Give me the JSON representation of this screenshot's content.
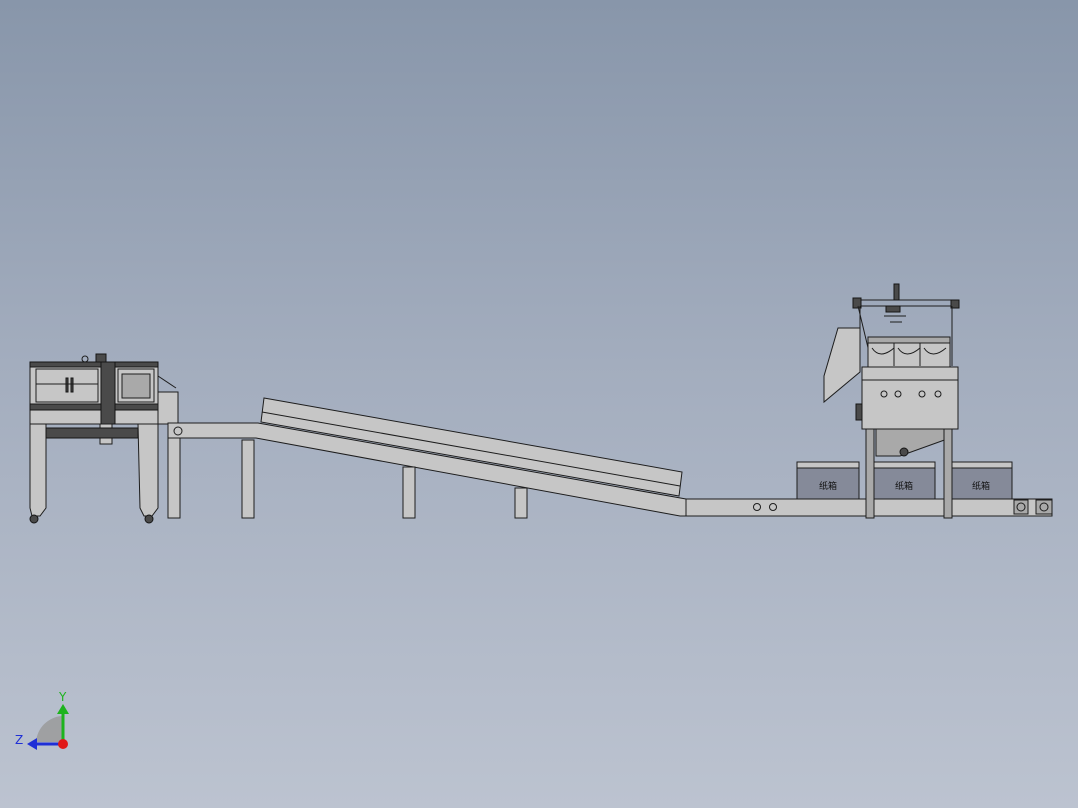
{
  "model": {
    "bin_labels": [
      "纸箱",
      "纸箱",
      "纸箱"
    ]
  },
  "triad": {
    "y_label": "Y",
    "z_label": "Z",
    "colors": {
      "y": "#1db31d",
      "z": "#1f2fd6",
      "x": "#e01818"
    }
  }
}
